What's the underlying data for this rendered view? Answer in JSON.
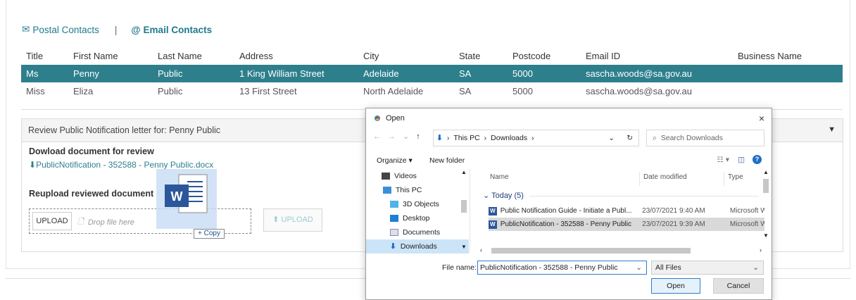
{
  "tabs": {
    "postal": "Postal Contacts",
    "separator": "|",
    "email": "Email Contacts"
  },
  "table": {
    "headers": [
      "Title",
      "First Name",
      "Last Name",
      "Address",
      "City",
      "State",
      "Postcode",
      "Email ID",
      "Business Name"
    ],
    "rows": [
      [
        "Ms",
        "Penny",
        "Public",
        "1 King William Street",
        "Adelaide",
        "SA",
        "5000",
        "sascha.woods@sa.gov.au",
        ""
      ],
      [
        "Miss",
        "Eliza",
        "Public",
        "13 First Street",
        "North Adelaide",
        "SA",
        "5000",
        "sascha.woods@sa.gov.au",
        ""
      ]
    ]
  },
  "review": {
    "header": "Review Public Notification letter for: Penny Public",
    "download_label": "Dowload document for review",
    "download_link": "PublicNotification - 352588 - Penny Public.docx",
    "reupload_label": "Reupload reviewed document",
    "upload_button": "UPLOAD",
    "drop_placeholder": "Drop file here",
    "upload_button2": "UPLOAD",
    "copy_tooltip": "+ Copy",
    "drag_icon_letter": "W"
  },
  "dialog": {
    "title": "Open",
    "close": "×",
    "path": [
      "This PC",
      "Downloads"
    ],
    "search_placeholder": "Search Downloads",
    "organize": "Organize ▾",
    "new_folder": "New folder",
    "nav_items": [
      "Videos",
      "This PC",
      "3D Objects",
      "Desktop",
      "Documents",
      "Downloads"
    ],
    "columns": [
      "Name",
      "Date modified",
      "Type"
    ],
    "group": "Today (5)",
    "files": [
      {
        "name": "Public Notification Guide - Initiate a Publ...",
        "date": "23/07/2021 9:40 AM",
        "type": "Microsoft W"
      },
      {
        "name": "PublicNotification - 352588 - Penny Public",
        "date": "23/07/2021 9:39 AM",
        "type": "Microsoft W"
      }
    ],
    "file_name_label": "File name:",
    "file_name_value": "PublicNotification - 352588 - Penny Public",
    "file_type": "All Files",
    "open_button": "Open",
    "cancel_button": "Cancel"
  },
  "colors": {
    "accent": "#2e7f8c",
    "selected_row": "#2e7f8c",
    "word_blue": "#2b579a"
  }
}
